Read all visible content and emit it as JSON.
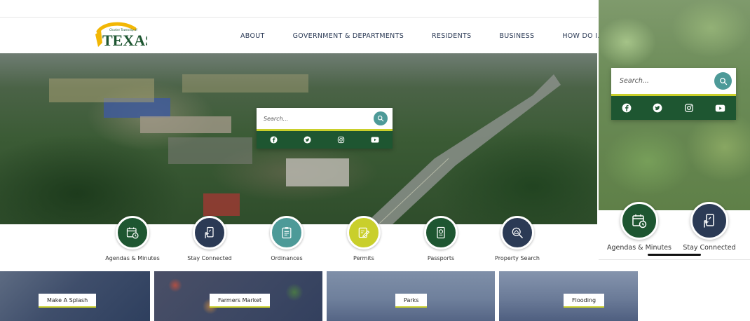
{
  "brand": {
    "logo_small_text": "Charter Township of",
    "logo_text": "TEXAS",
    "logo_colors": {
      "text": "#1e5631",
      "swoosh": "#f2b705"
    }
  },
  "nav": {
    "items": [
      "ABOUT",
      "GOVERNMENT & DEPARTMENTS",
      "RESIDENTS",
      "BUSINESS",
      "HOW DO I..."
    ]
  },
  "search": {
    "placeholder": "Search...",
    "icon": "search-icon"
  },
  "social": [
    {
      "name": "facebook",
      "icon": "facebook-icon"
    },
    {
      "name": "twitter",
      "icon": "twitter-icon"
    },
    {
      "name": "instagram",
      "icon": "instagram-icon"
    },
    {
      "name": "youtube",
      "icon": "youtube-icon"
    }
  ],
  "quick_links": [
    {
      "label": "Agendas & Minutes",
      "icon": "calendar-clock-icon",
      "color": "#1e5631"
    },
    {
      "label": "Stay Connected",
      "icon": "phone-hand-icon",
      "color": "#2b3a55"
    },
    {
      "label": "Ordinances",
      "icon": "clipboard-icon",
      "color": "#4d9a98"
    },
    {
      "label": "Permits",
      "icon": "edit-document-icon",
      "color": "#c9cf2b"
    },
    {
      "label": "Passports",
      "icon": "passport-icon",
      "color": "#1e5631"
    },
    {
      "label": "Property Search",
      "icon": "house-search-icon",
      "color": "#2b3a55"
    }
  ],
  "cards": [
    {
      "label": "Make A Splash"
    },
    {
      "label": "Farmers Market"
    },
    {
      "label": "Parks"
    },
    {
      "label": "Flooding"
    }
  ],
  "mobile_panel": {
    "quick_links": [
      {
        "label": "Agendas & Minutes",
        "icon": "calendar-clock-icon",
        "color": "#1e5631"
      },
      {
        "label": "Stay Connected",
        "icon": "phone-hand-icon",
        "color": "#2b3a55"
      }
    ]
  },
  "colors": {
    "primary_green": "#1e5631",
    "navy": "#2b3a55",
    "teal": "#4d9a98",
    "accent_yellow": "#c9cf2b"
  }
}
